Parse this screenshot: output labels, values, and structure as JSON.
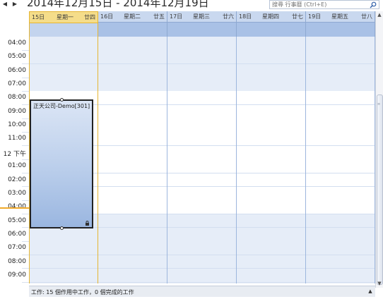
{
  "toolbar": {
    "prev_label": "◀",
    "next_label": "▶",
    "date_range": "2014年12月15日 - 2014年12月19日",
    "search_placeholder": "搜尋 行事曆 (Ctrl+E)",
    "search_icon": "search-icon"
  },
  "days": [
    {
      "num": "15日",
      "weekday": "星期一",
      "lunar": "廿四",
      "today": true
    },
    {
      "num": "16日",
      "weekday": "星期二",
      "lunar": "廿五",
      "today": false
    },
    {
      "num": "17日",
      "weekday": "星期三",
      "lunar": "廿六",
      "today": false
    },
    {
      "num": "18日",
      "weekday": "星期四",
      "lunar": "廿七",
      "today": false
    },
    {
      "num": "19日",
      "weekday": "星期五",
      "lunar": "廿八",
      "today": false
    }
  ],
  "time_labels": [
    "04:00",
    "05:00",
    "06:00",
    "07:00",
    "08:00",
    "09:00",
    "10:00",
    "11:00",
    "12 下午",
    "01:00",
    "02:00",
    "03:00",
    "04:00",
    "05:00",
    "06:00",
    "07:00",
    "08:00",
    "09:00"
  ],
  "appointment": {
    "title": "正天公司-Demo[301]",
    "lock_icon": "lock-icon"
  },
  "task_bar": {
    "text": "工作: 15 個作用中工作，0 個完成的工作",
    "toggle": "▲"
  },
  "scrollbar": {
    "up": "▲",
    "down": "▼",
    "grip": "≡"
  },
  "colors": {
    "today_border": "#e5b532",
    "header_blue": "#a9c1e6",
    "appointment_blue": "#bdd0ec",
    "now_indicator": "#f0a92a"
  }
}
